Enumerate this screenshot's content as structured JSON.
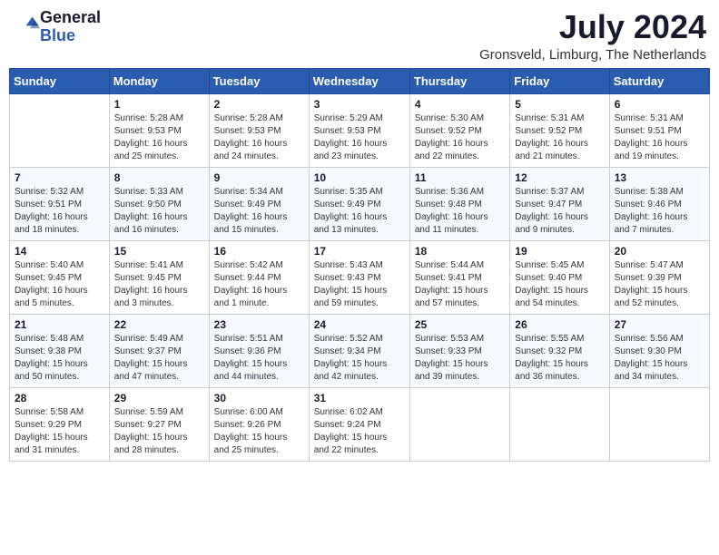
{
  "header": {
    "logo_line1": "General",
    "logo_line2": "Blue",
    "month_year": "July 2024",
    "location": "Gronsveld, Limburg, The Netherlands"
  },
  "weekdays": [
    "Sunday",
    "Monday",
    "Tuesday",
    "Wednesday",
    "Thursday",
    "Friday",
    "Saturday"
  ],
  "weeks": [
    [
      {
        "day": "",
        "info": ""
      },
      {
        "day": "1",
        "info": "Sunrise: 5:28 AM\nSunset: 9:53 PM\nDaylight: 16 hours\nand 25 minutes."
      },
      {
        "day": "2",
        "info": "Sunrise: 5:28 AM\nSunset: 9:53 PM\nDaylight: 16 hours\nand 24 minutes."
      },
      {
        "day": "3",
        "info": "Sunrise: 5:29 AM\nSunset: 9:53 PM\nDaylight: 16 hours\nand 23 minutes."
      },
      {
        "day": "4",
        "info": "Sunrise: 5:30 AM\nSunset: 9:52 PM\nDaylight: 16 hours\nand 22 minutes."
      },
      {
        "day": "5",
        "info": "Sunrise: 5:31 AM\nSunset: 9:52 PM\nDaylight: 16 hours\nand 21 minutes."
      },
      {
        "day": "6",
        "info": "Sunrise: 5:31 AM\nSunset: 9:51 PM\nDaylight: 16 hours\nand 19 minutes."
      }
    ],
    [
      {
        "day": "7",
        "info": "Sunrise: 5:32 AM\nSunset: 9:51 PM\nDaylight: 16 hours\nand 18 minutes."
      },
      {
        "day": "8",
        "info": "Sunrise: 5:33 AM\nSunset: 9:50 PM\nDaylight: 16 hours\nand 16 minutes."
      },
      {
        "day": "9",
        "info": "Sunrise: 5:34 AM\nSunset: 9:49 PM\nDaylight: 16 hours\nand 15 minutes."
      },
      {
        "day": "10",
        "info": "Sunrise: 5:35 AM\nSunset: 9:49 PM\nDaylight: 16 hours\nand 13 minutes."
      },
      {
        "day": "11",
        "info": "Sunrise: 5:36 AM\nSunset: 9:48 PM\nDaylight: 16 hours\nand 11 minutes."
      },
      {
        "day": "12",
        "info": "Sunrise: 5:37 AM\nSunset: 9:47 PM\nDaylight: 16 hours\nand 9 minutes."
      },
      {
        "day": "13",
        "info": "Sunrise: 5:38 AM\nSunset: 9:46 PM\nDaylight: 16 hours\nand 7 minutes."
      }
    ],
    [
      {
        "day": "14",
        "info": "Sunrise: 5:40 AM\nSunset: 9:45 PM\nDaylight: 16 hours\nand 5 minutes."
      },
      {
        "day": "15",
        "info": "Sunrise: 5:41 AM\nSunset: 9:45 PM\nDaylight: 16 hours\nand 3 minutes."
      },
      {
        "day": "16",
        "info": "Sunrise: 5:42 AM\nSunset: 9:44 PM\nDaylight: 16 hours\nand 1 minute."
      },
      {
        "day": "17",
        "info": "Sunrise: 5:43 AM\nSunset: 9:43 PM\nDaylight: 15 hours\nand 59 minutes."
      },
      {
        "day": "18",
        "info": "Sunrise: 5:44 AM\nSunset: 9:41 PM\nDaylight: 15 hours\nand 57 minutes."
      },
      {
        "day": "19",
        "info": "Sunrise: 5:45 AM\nSunset: 9:40 PM\nDaylight: 15 hours\nand 54 minutes."
      },
      {
        "day": "20",
        "info": "Sunrise: 5:47 AM\nSunset: 9:39 PM\nDaylight: 15 hours\nand 52 minutes."
      }
    ],
    [
      {
        "day": "21",
        "info": "Sunrise: 5:48 AM\nSunset: 9:38 PM\nDaylight: 15 hours\nand 50 minutes."
      },
      {
        "day": "22",
        "info": "Sunrise: 5:49 AM\nSunset: 9:37 PM\nDaylight: 15 hours\nand 47 minutes."
      },
      {
        "day": "23",
        "info": "Sunrise: 5:51 AM\nSunset: 9:36 PM\nDaylight: 15 hours\nand 44 minutes."
      },
      {
        "day": "24",
        "info": "Sunrise: 5:52 AM\nSunset: 9:34 PM\nDaylight: 15 hours\nand 42 minutes."
      },
      {
        "day": "25",
        "info": "Sunrise: 5:53 AM\nSunset: 9:33 PM\nDaylight: 15 hours\nand 39 minutes."
      },
      {
        "day": "26",
        "info": "Sunrise: 5:55 AM\nSunset: 9:32 PM\nDaylight: 15 hours\nand 36 minutes."
      },
      {
        "day": "27",
        "info": "Sunrise: 5:56 AM\nSunset: 9:30 PM\nDaylight: 15 hours\nand 34 minutes."
      }
    ],
    [
      {
        "day": "28",
        "info": "Sunrise: 5:58 AM\nSunset: 9:29 PM\nDaylight: 15 hours\nand 31 minutes."
      },
      {
        "day": "29",
        "info": "Sunrise: 5:59 AM\nSunset: 9:27 PM\nDaylight: 15 hours\nand 28 minutes."
      },
      {
        "day": "30",
        "info": "Sunrise: 6:00 AM\nSunset: 9:26 PM\nDaylight: 15 hours\nand 25 minutes."
      },
      {
        "day": "31",
        "info": "Sunrise: 6:02 AM\nSunset: 9:24 PM\nDaylight: 15 hours\nand 22 minutes."
      },
      {
        "day": "",
        "info": ""
      },
      {
        "day": "",
        "info": ""
      },
      {
        "day": "",
        "info": ""
      }
    ]
  ]
}
